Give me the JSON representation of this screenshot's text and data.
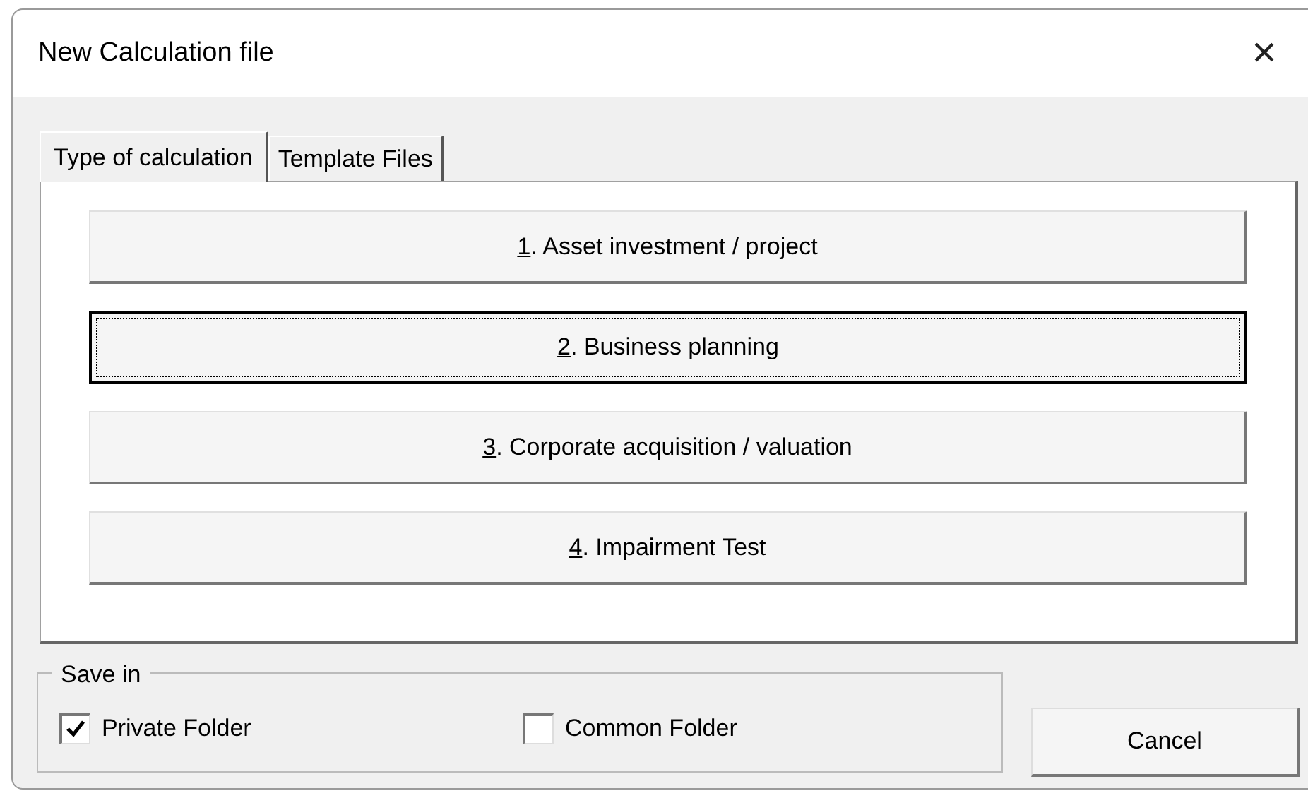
{
  "window": {
    "title": "New Calculation file",
    "close": "×"
  },
  "tabs": [
    {
      "label": "Type of calculation",
      "selected": true
    },
    {
      "label": "Template Files",
      "selected": false
    }
  ],
  "calculation_buttons": [
    {
      "mnemonic": "1",
      "label": ". Asset investment / project",
      "focused": false
    },
    {
      "mnemonic": "2",
      "label": ". Business planning",
      "focused": true
    },
    {
      "mnemonic": "3",
      "label": ". Corporate acquisition / valuation",
      "focused": false
    },
    {
      "mnemonic": "4",
      "label": ". Impairment Test",
      "focused": false
    }
  ],
  "save_in": {
    "legend": "Save in",
    "options": [
      {
        "label": "Private Folder",
        "checked": true
      },
      {
        "label": "Common Folder",
        "checked": false
      }
    ]
  },
  "buttons": [
    "Cancel"
  ]
}
